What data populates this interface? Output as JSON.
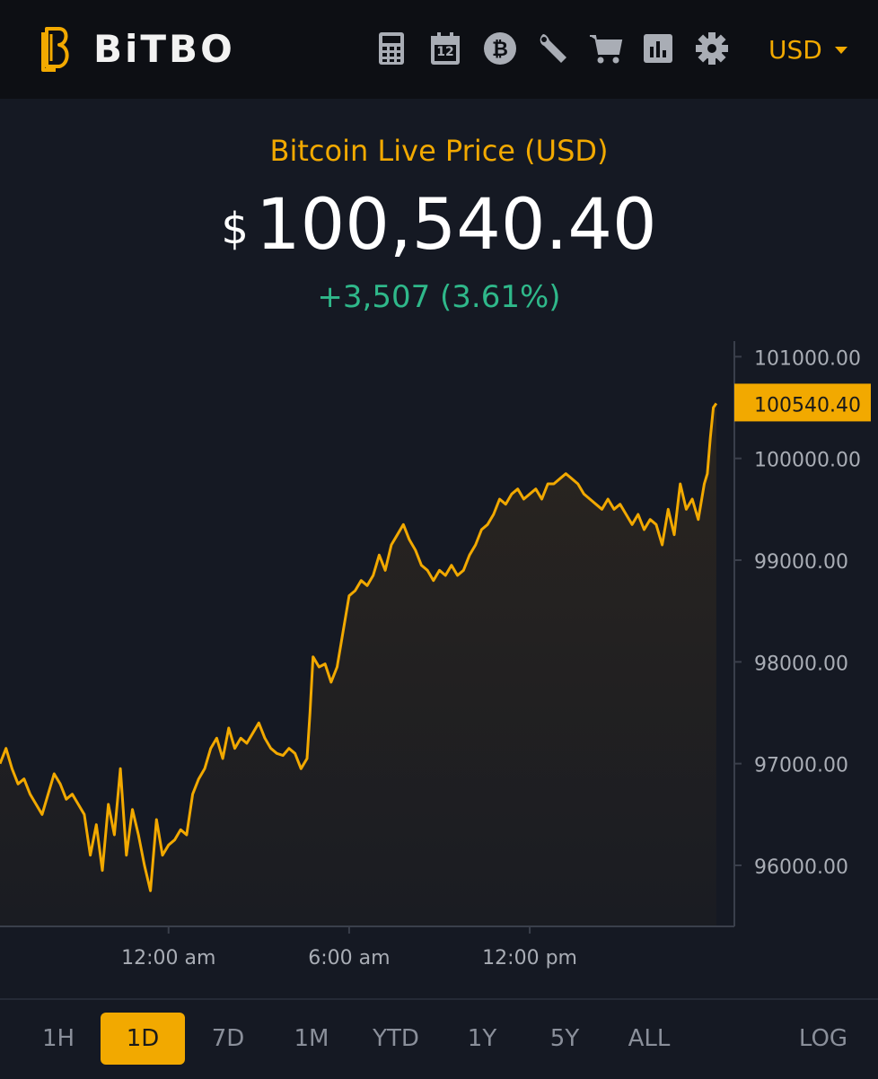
{
  "header": {
    "brand": "BiTBO",
    "tools": [
      "calculator-icon",
      "calendar-icon",
      "bitcoin-icon",
      "wrench-icon",
      "cart-icon",
      "bar-chart-icon",
      "gear-icon"
    ],
    "calendar_day": "12",
    "currency": "USD"
  },
  "title": "Bitcoin Live Price (USD)",
  "price": {
    "currency_symbol": "$",
    "value": "100,540.40"
  },
  "change": "+3,507 (3.61%)",
  "colors": {
    "accent": "#f2a900",
    "positive": "#2fb88a",
    "background": "#151923",
    "topbar": "#0d0f14"
  },
  "chart_data": {
    "type": "area",
    "ylabel_ticks": [
      "101000.00",
      "100000.00",
      "99000.00",
      "98000.00",
      "97000.00",
      "96000.00"
    ],
    "y_ticks": [
      101000,
      100000,
      99000,
      98000,
      97000,
      96000
    ],
    "x_ticks": [
      "12:00 am",
      "6:00 am",
      "12:00 pm"
    ],
    "x_tick_hours": [
      0,
      6,
      12
    ],
    "ylim": [
      95400,
      101100
    ],
    "xlim": [
      -5.6,
      18.5
    ],
    "current_value": 100540.4,
    "current_label": "100540.40",
    "series": [
      {
        "values": [
          [
            -5.6,
            97000
          ],
          [
            -5.4,
            97150
          ],
          [
            -5.2,
            96950
          ],
          [
            -5.0,
            96800
          ],
          [
            -4.8,
            96850
          ],
          [
            -4.6,
            96700
          ],
          [
            -4.4,
            96600
          ],
          [
            -4.2,
            96500
          ],
          [
            -4.0,
            96700
          ],
          [
            -3.8,
            96900
          ],
          [
            -3.6,
            96800
          ],
          [
            -3.4,
            96650
          ],
          [
            -3.2,
            96700
          ],
          [
            -3.0,
            96600
          ],
          [
            -2.8,
            96500
          ],
          [
            -2.6,
            96100
          ],
          [
            -2.4,
            96400
          ],
          [
            -2.2,
            95950
          ],
          [
            -2.0,
            96600
          ],
          [
            -1.8,
            96300
          ],
          [
            -1.6,
            96950
          ],
          [
            -1.4,
            96100
          ],
          [
            -1.2,
            96550
          ],
          [
            -1.0,
            96300
          ],
          [
            -0.8,
            96000
          ],
          [
            -0.6,
            95750
          ],
          [
            -0.4,
            96450
          ],
          [
            -0.2,
            96100
          ],
          [
            0.0,
            96200
          ],
          [
            0.2,
            96250
          ],
          [
            0.4,
            96350
          ],
          [
            0.6,
            96300
          ],
          [
            0.8,
            96700
          ],
          [
            1.0,
            96850
          ],
          [
            1.2,
            96950
          ],
          [
            1.4,
            97150
          ],
          [
            1.6,
            97250
          ],
          [
            1.8,
            97050
          ],
          [
            2.0,
            97350
          ],
          [
            2.2,
            97150
          ],
          [
            2.4,
            97250
          ],
          [
            2.6,
            97200
          ],
          [
            2.8,
            97300
          ],
          [
            3.0,
            97400
          ],
          [
            3.2,
            97250
          ],
          [
            3.4,
            97150
          ],
          [
            3.6,
            97100
          ],
          [
            3.8,
            97080
          ],
          [
            4.0,
            97150
          ],
          [
            4.2,
            97100
          ],
          [
            4.4,
            96950
          ],
          [
            4.6,
            97050
          ],
          [
            4.7,
            97500
          ],
          [
            4.8,
            98050
          ],
          [
            5.0,
            97950
          ],
          [
            5.2,
            97980
          ],
          [
            5.4,
            97800
          ],
          [
            5.6,
            97950
          ],
          [
            5.8,
            98300
          ],
          [
            6.0,
            98650
          ],
          [
            6.2,
            98700
          ],
          [
            6.4,
            98800
          ],
          [
            6.6,
            98750
          ],
          [
            6.8,
            98850
          ],
          [
            7.0,
            99050
          ],
          [
            7.2,
            98900
          ],
          [
            7.4,
            99150
          ],
          [
            7.6,
            99250
          ],
          [
            7.8,
            99350
          ],
          [
            8.0,
            99200
          ],
          [
            8.2,
            99100
          ],
          [
            8.4,
            98950
          ],
          [
            8.6,
            98900
          ],
          [
            8.8,
            98800
          ],
          [
            9.0,
            98900
          ],
          [
            9.2,
            98850
          ],
          [
            9.4,
            98950
          ],
          [
            9.6,
            98850
          ],
          [
            9.8,
            98900
          ],
          [
            10.0,
            99050
          ],
          [
            10.2,
            99150
          ],
          [
            10.4,
            99300
          ],
          [
            10.6,
            99350
          ],
          [
            10.8,
            99450
          ],
          [
            11.0,
            99600
          ],
          [
            11.2,
            99550
          ],
          [
            11.4,
            99650
          ],
          [
            11.6,
            99700
          ],
          [
            11.8,
            99600
          ],
          [
            12.0,
            99650
          ],
          [
            12.2,
            99700
          ],
          [
            12.4,
            99600
          ],
          [
            12.6,
            99750
          ],
          [
            12.8,
            99750
          ],
          [
            13.0,
            99800
          ],
          [
            13.2,
            99850
          ],
          [
            13.4,
            99800
          ],
          [
            13.6,
            99750
          ],
          [
            13.8,
            99650
          ],
          [
            14.0,
            99600
          ],
          [
            14.2,
            99550
          ],
          [
            14.4,
            99500
          ],
          [
            14.6,
            99600
          ],
          [
            14.8,
            99500
          ],
          [
            15.0,
            99550
          ],
          [
            15.2,
            99450
          ],
          [
            15.4,
            99350
          ],
          [
            15.6,
            99450
          ],
          [
            15.8,
            99300
          ],
          [
            16.0,
            99400
          ],
          [
            16.2,
            99350
          ],
          [
            16.4,
            99150
          ],
          [
            16.6,
            99500
          ],
          [
            16.8,
            99250
          ],
          [
            17.0,
            99750
          ],
          [
            17.2,
            99500
          ],
          [
            17.4,
            99600
          ],
          [
            17.6,
            99400
          ],
          [
            17.8,
            99750
          ],
          [
            17.9,
            99850
          ],
          [
            18.0,
            100200
          ],
          [
            18.1,
            100500
          ],
          [
            18.2,
            100540.4
          ]
        ]
      }
    ]
  },
  "ranges": [
    "1H",
    "1D",
    "7D",
    "1M",
    "YTD",
    "1Y",
    "5Y",
    "ALL"
  ],
  "active_range": "1D",
  "log_label": "LOG"
}
